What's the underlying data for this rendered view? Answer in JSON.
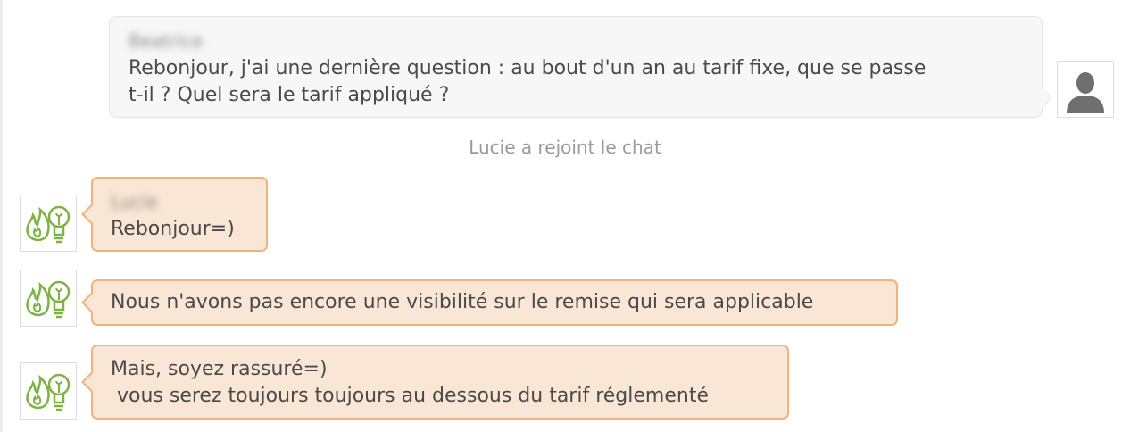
{
  "messages": {
    "user_message": {
      "sender_name": "Beatrice",
      "line1": "Rebonjour, j'ai une dernière question : au bout d'un an au tarif fixe, que se passe",
      "line2": "t-il ? Quel sera le tarif appliqué ?"
    },
    "system_message": "Lucie a rejoint le chat",
    "agent_messages": [
      {
        "sender_name": "Lucie",
        "lines": [
          "Rebonjour=)"
        ]
      },
      {
        "lines": [
          "Nous n'avons pas encore une visibilité sur le remise qui sera applicable"
        ]
      },
      {
        "lines": [
          "Mais, soyez rassuré=)",
          " vous serez toujours toujours au dessous du tarif réglementé"
        ]
      }
    ]
  },
  "avatars": {
    "user_icon": "user-silhouette-icon",
    "agent_icon": "gas-flame-lightbulb-logo-icon"
  },
  "colors": {
    "agent_bubble_bg": "#fae6d4",
    "agent_bubble_border": "#f2b37a",
    "user_bubble_bg": "#f7f7f7",
    "logo_green": "#7cb342",
    "system_text": "#9a9a9a"
  }
}
